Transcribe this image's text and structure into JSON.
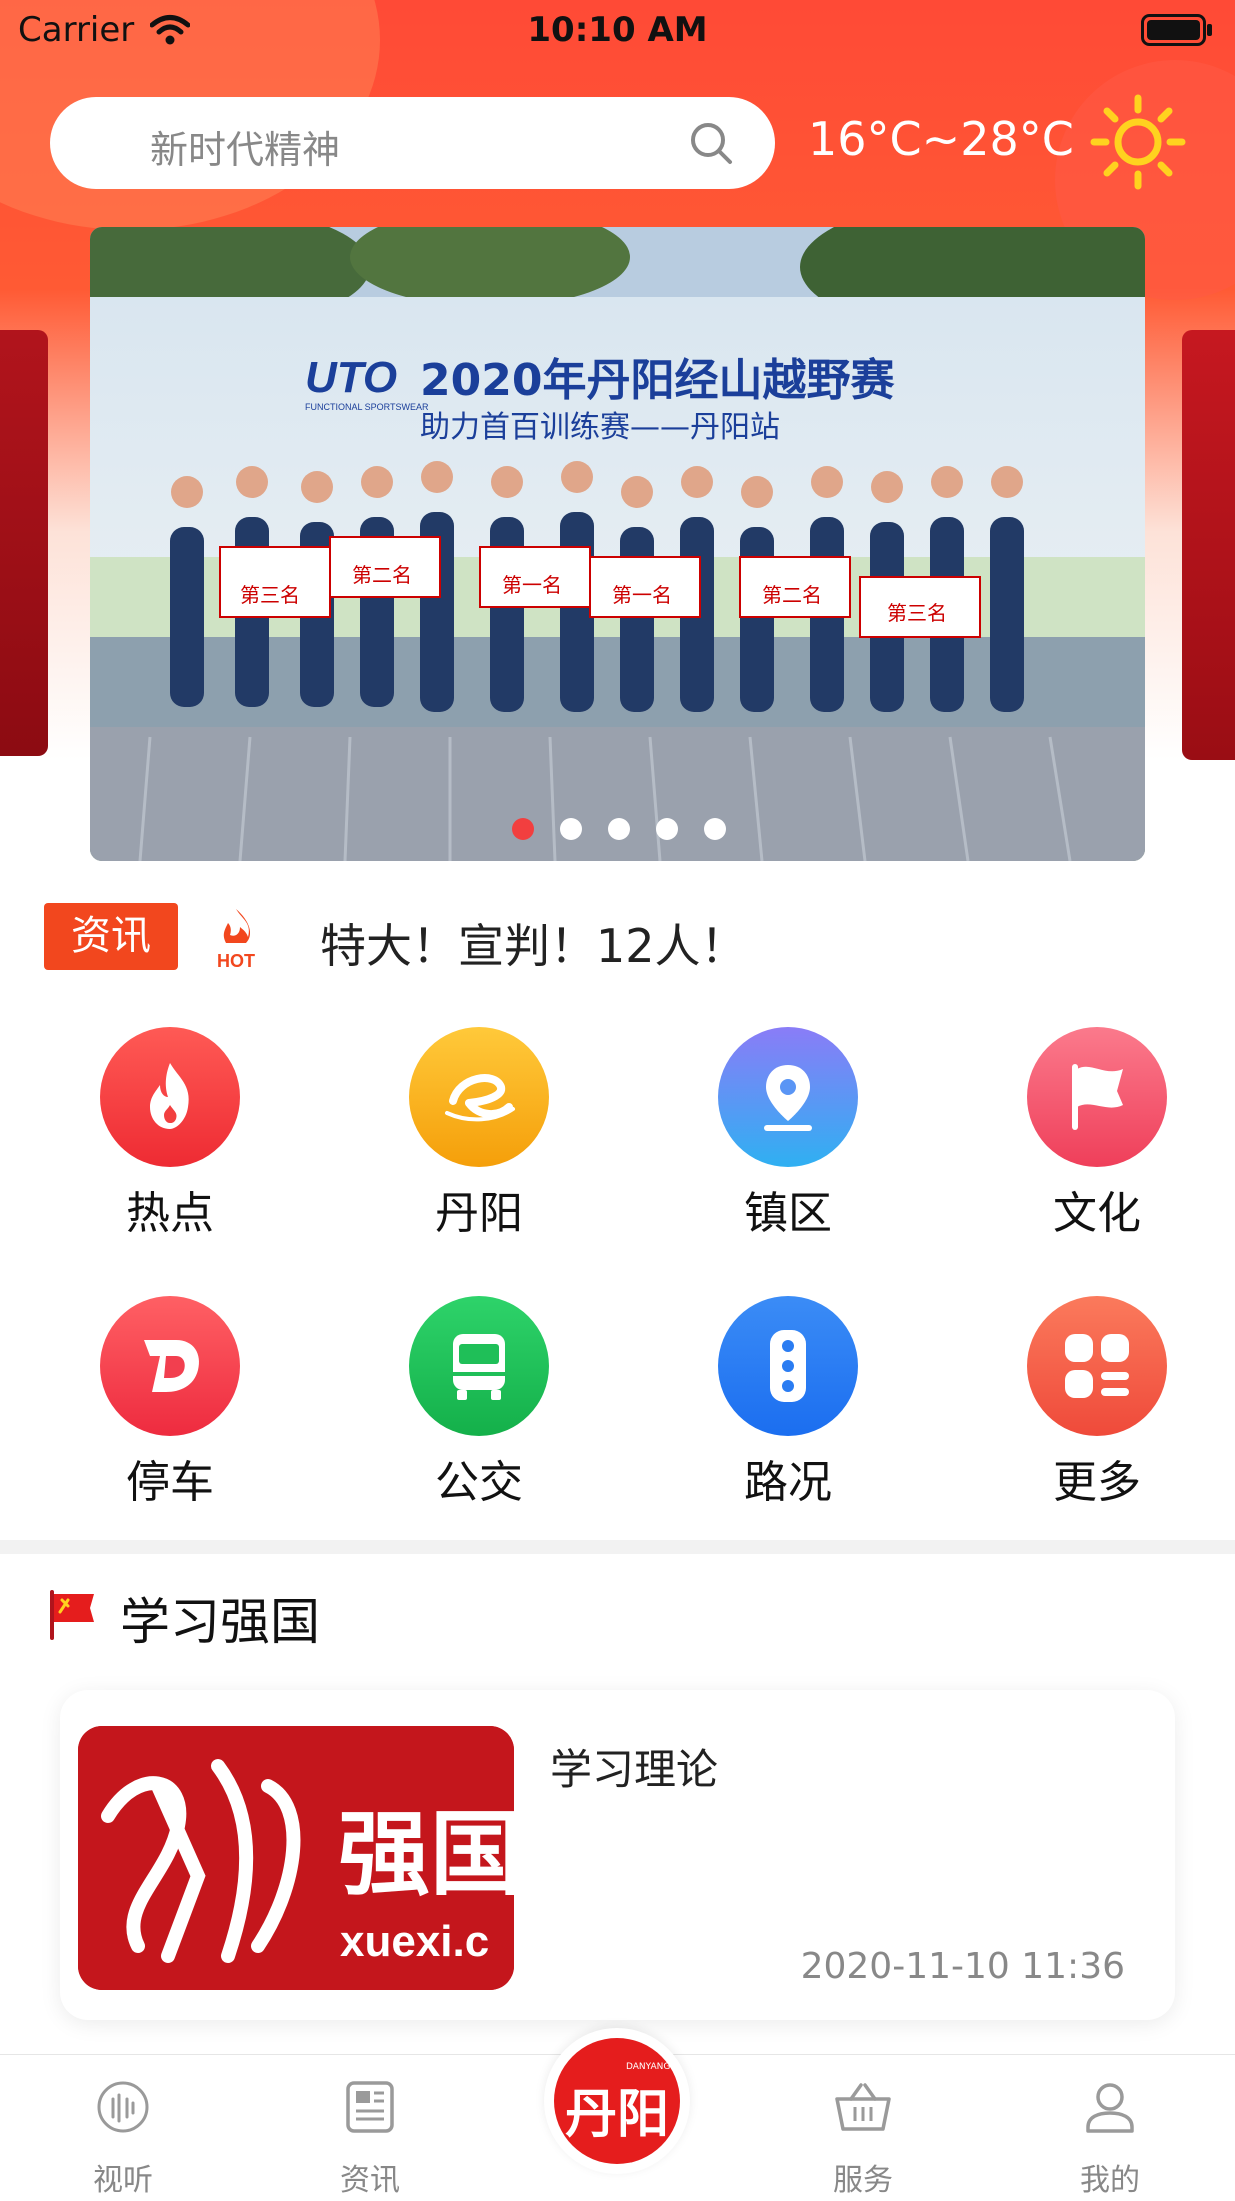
{
  "status_bar": {
    "carrier": "Carrier",
    "time": "10:10 AM"
  },
  "header": {
    "search_placeholder": "新时代精神",
    "weather": "16°C~28°C"
  },
  "banner": {
    "title": "2020年丹阳经山越野赛",
    "subtitle": "助力首百训练赛——丹阳站",
    "brand": "UTO",
    "brand_sub": "FUNCTIONAL SPORTSWEAR",
    "placards": [
      "第三名",
      "第二名",
      "第一名",
      "第一名",
      "第二名",
      "第三名"
    ],
    "page_count": 5,
    "active_page": 1
  },
  "news": {
    "tag": "资讯",
    "hot_label": "HOT",
    "headline": "特大！宣判！12人！"
  },
  "quick_grid": [
    {
      "label": "热点",
      "icon": "flame-icon",
      "color": "#f23f3f"
    },
    {
      "label": "丹阳",
      "icon": "e-logo-icon",
      "color": "#fbb31d"
    },
    {
      "label": "镇区",
      "icon": "location-pin-icon",
      "color": "#3f8ef5"
    },
    {
      "label": "文化",
      "icon": "flag-icon",
      "color": "#f2566e"
    },
    {
      "label": "停车",
      "icon": "parking-d-icon",
      "color": "#f23f4f"
    },
    {
      "label": "公交",
      "icon": "bus-icon",
      "color": "#1fbf58"
    },
    {
      "label": "路况",
      "icon": "traffic-light-icon",
      "color": "#2a7cf2"
    },
    {
      "label": "更多",
      "icon": "grid-more-icon",
      "color": "#f46349"
    }
  ],
  "study": {
    "section_title": "学习强国",
    "card": {
      "title": "学习理论",
      "date": "2020-11-10 11:36",
      "thumb_text": "强国",
      "thumb_url_text": "xuexi.c"
    }
  },
  "tab_bar": {
    "tabs": [
      {
        "label": "视听",
        "icon": "audio-visual-icon"
      },
      {
        "label": "资讯",
        "icon": "newspaper-icon"
      },
      {
        "label": "服务",
        "icon": "basket-icon"
      },
      {
        "label": "我的",
        "icon": "user-icon"
      }
    ],
    "center_logo_text": "丹阳",
    "center_logo_sub": "DANYANG"
  },
  "colors": {
    "accent": "#f2471e",
    "header_gradient_top": "#ff4a36",
    "active_dot": "#f23f3f"
  }
}
